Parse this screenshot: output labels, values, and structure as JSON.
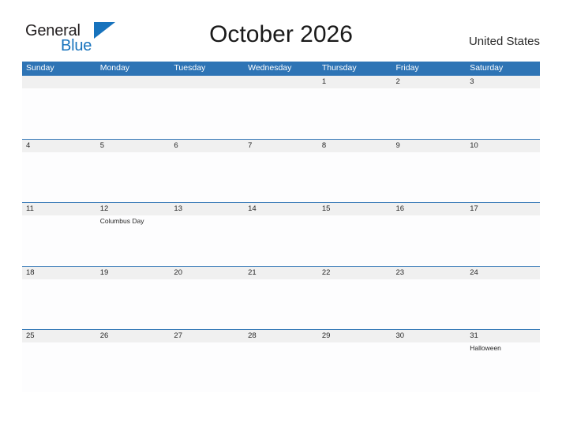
{
  "brand": {
    "name_part1": "General",
    "name_part2": "Blue",
    "flag_icon": "blue-flag-triangle-icon",
    "accent_color": "#1773bd"
  },
  "header": {
    "title": "October 2026",
    "country": "United States"
  },
  "theme": {
    "header_blue": "#2e74b5",
    "date_band_gray": "#f0f0f0",
    "cell_white": "#fdfdfe",
    "text_dark": "#262626"
  },
  "calendar": {
    "month": "October",
    "year": "2026",
    "day_headers": [
      "Sunday",
      "Monday",
      "Tuesday",
      "Wednesday",
      "Thursday",
      "Friday",
      "Saturday"
    ],
    "weeks": [
      {
        "days": [
          {
            "date": "",
            "event": ""
          },
          {
            "date": "",
            "event": ""
          },
          {
            "date": "",
            "event": ""
          },
          {
            "date": "",
            "event": ""
          },
          {
            "date": "1",
            "event": ""
          },
          {
            "date": "2",
            "event": ""
          },
          {
            "date": "3",
            "event": ""
          }
        ]
      },
      {
        "days": [
          {
            "date": "4",
            "event": ""
          },
          {
            "date": "5",
            "event": ""
          },
          {
            "date": "6",
            "event": ""
          },
          {
            "date": "7",
            "event": ""
          },
          {
            "date": "8",
            "event": ""
          },
          {
            "date": "9",
            "event": ""
          },
          {
            "date": "10",
            "event": ""
          }
        ]
      },
      {
        "days": [
          {
            "date": "11",
            "event": ""
          },
          {
            "date": "12",
            "event": "Columbus Day"
          },
          {
            "date": "13",
            "event": ""
          },
          {
            "date": "14",
            "event": ""
          },
          {
            "date": "15",
            "event": ""
          },
          {
            "date": "16",
            "event": ""
          },
          {
            "date": "17",
            "event": ""
          }
        ]
      },
      {
        "days": [
          {
            "date": "18",
            "event": ""
          },
          {
            "date": "19",
            "event": ""
          },
          {
            "date": "20",
            "event": ""
          },
          {
            "date": "21",
            "event": ""
          },
          {
            "date": "22",
            "event": ""
          },
          {
            "date": "23",
            "event": ""
          },
          {
            "date": "24",
            "event": ""
          }
        ]
      },
      {
        "days": [
          {
            "date": "25",
            "event": ""
          },
          {
            "date": "26",
            "event": ""
          },
          {
            "date": "27",
            "event": ""
          },
          {
            "date": "28",
            "event": ""
          },
          {
            "date": "29",
            "event": ""
          },
          {
            "date": "30",
            "event": ""
          },
          {
            "date": "31",
            "event": "Halloween"
          }
        ]
      }
    ]
  }
}
